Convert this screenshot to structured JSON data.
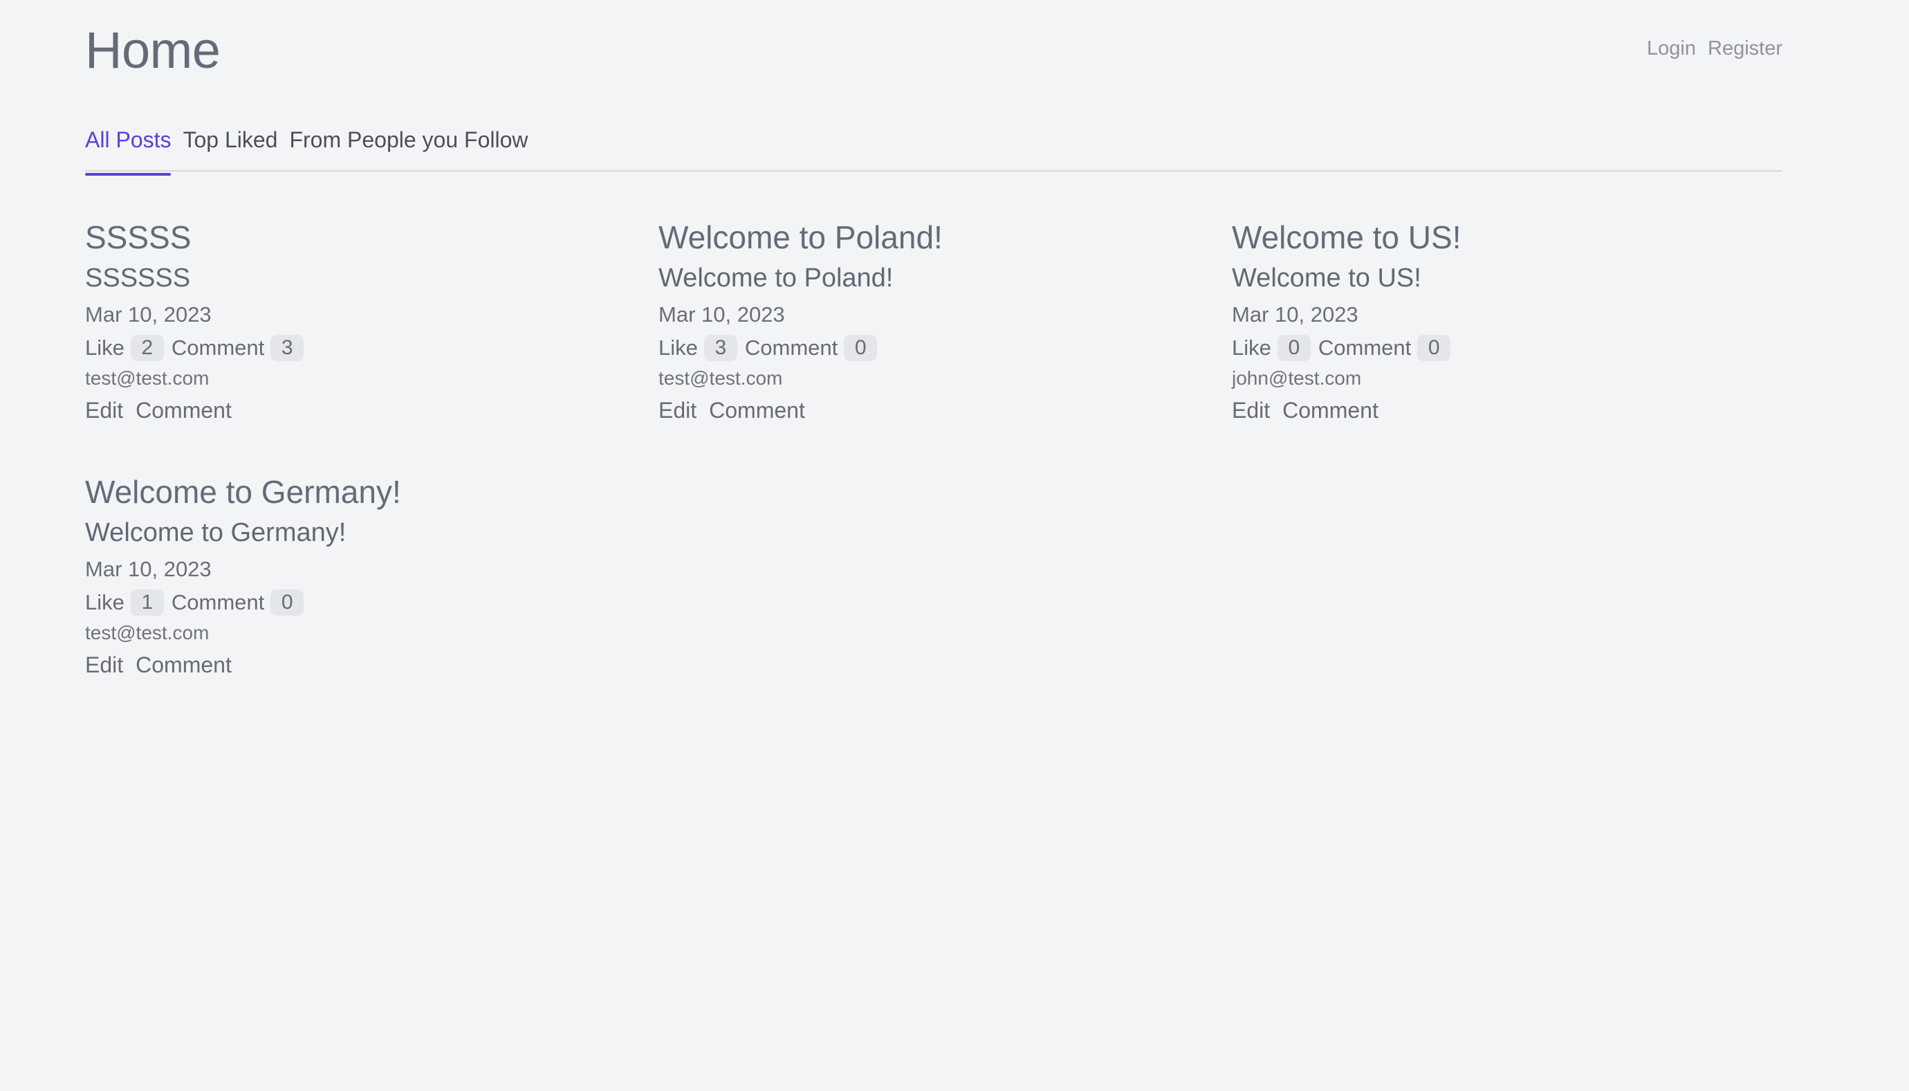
{
  "header": {
    "title": "Home",
    "login_label": "Login",
    "register_label": "Register"
  },
  "tabs": [
    {
      "label": "All Posts",
      "active": true
    },
    {
      "label": "Top Liked",
      "active": false
    },
    {
      "label": "From People you Follow",
      "active": false
    }
  ],
  "posts": [
    {
      "title": "SSSSS",
      "body": "SSSSSS",
      "date": "Mar 10, 2023",
      "like_label": "Like",
      "likes": "2",
      "comment_label": "Comment",
      "comments": "3",
      "author": "test@test.com",
      "edit_label": "Edit",
      "comment_action_label": "Comment"
    },
    {
      "title": "Welcome to Poland!",
      "body": "Welcome to Poland!",
      "date": "Mar 10, 2023",
      "like_label": "Like",
      "likes": "3",
      "comment_label": "Comment",
      "comments": "0",
      "author": "test@test.com",
      "edit_label": "Edit",
      "comment_action_label": "Comment"
    },
    {
      "title": "Welcome to US!",
      "body": "Welcome to US!",
      "date": "Mar 10, 2023",
      "like_label": "Like",
      "likes": "0",
      "comment_label": "Comment",
      "comments": "0",
      "author": "john@test.com",
      "edit_label": "Edit",
      "comment_action_label": "Comment"
    },
    {
      "title": "Welcome to Germany!",
      "body": "Welcome to Germany!",
      "date": "Mar 10, 2023",
      "like_label": "Like",
      "likes": "1",
      "comment_label": "Comment",
      "comments": "0",
      "author": "test@test.com",
      "edit_label": "Edit",
      "comment_action_label": "Comment"
    }
  ],
  "colors": {
    "background": "#f3f4f6",
    "accent": "#5b40d6",
    "text": "#646a78",
    "badge_bg": "#e4e6ea"
  }
}
